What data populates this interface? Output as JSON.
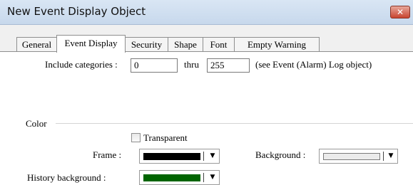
{
  "window": {
    "title": "New Event Display Object",
    "close_glyph": "✕"
  },
  "tabs": [
    {
      "label": "General"
    },
    {
      "label": "Event Display"
    },
    {
      "label": "Security"
    },
    {
      "label": "Shape"
    },
    {
      "label": "Font"
    },
    {
      "label": "Empty Warning"
    }
  ],
  "active_tab": "Event Display",
  "categories": {
    "label": "Include categories :",
    "from_value": "0",
    "thru_label": "thru",
    "to_value": "255",
    "note": "(see Event (Alarm) Log object)"
  },
  "color": {
    "group_label": "Color",
    "transparent_label": "Transparent",
    "transparent_checked": false,
    "frame_label": "Frame :",
    "frame_color": "#000000",
    "background_label": "Background :",
    "background_color": "#ebebeb",
    "history_label": "History background :",
    "history_color": "#006400",
    "dropdown_arrow": "▼"
  }
}
